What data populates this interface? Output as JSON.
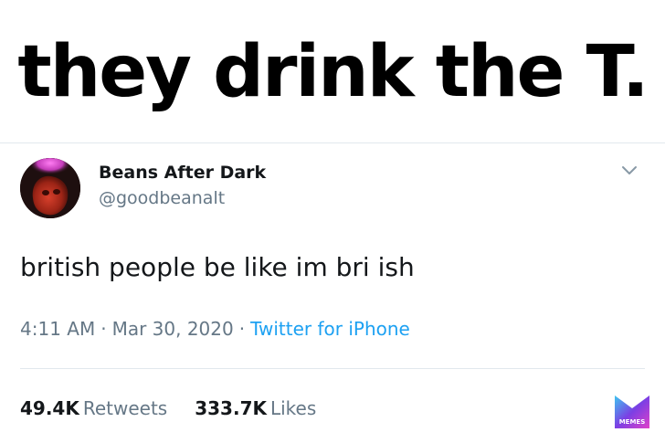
{
  "caption": "they drink the T.",
  "tweet": {
    "display_name": "Beans After Dark",
    "handle": "@goodbeanalt",
    "text": "british people be like im bri ish",
    "time": "4:11 AM",
    "date": "Mar 30, 2020",
    "source": "Twitter for iPhone",
    "separator": "·",
    "retweets_count": "49.4K",
    "retweets_label": "Retweets",
    "likes_count": "333.7K",
    "likes_label": "Likes"
  },
  "watermark": {
    "text": "MEMES",
    "colors": [
      "#3ec6f0",
      "#7b3fe4",
      "#e040c8"
    ]
  },
  "icons": {
    "menu": "chevron-down-icon",
    "avatar": "avatar"
  },
  "colors": {
    "text_primary": "#14171a",
    "text_secondary": "#657786",
    "link": "#1da1f2",
    "divider": "#e1e8ed"
  }
}
